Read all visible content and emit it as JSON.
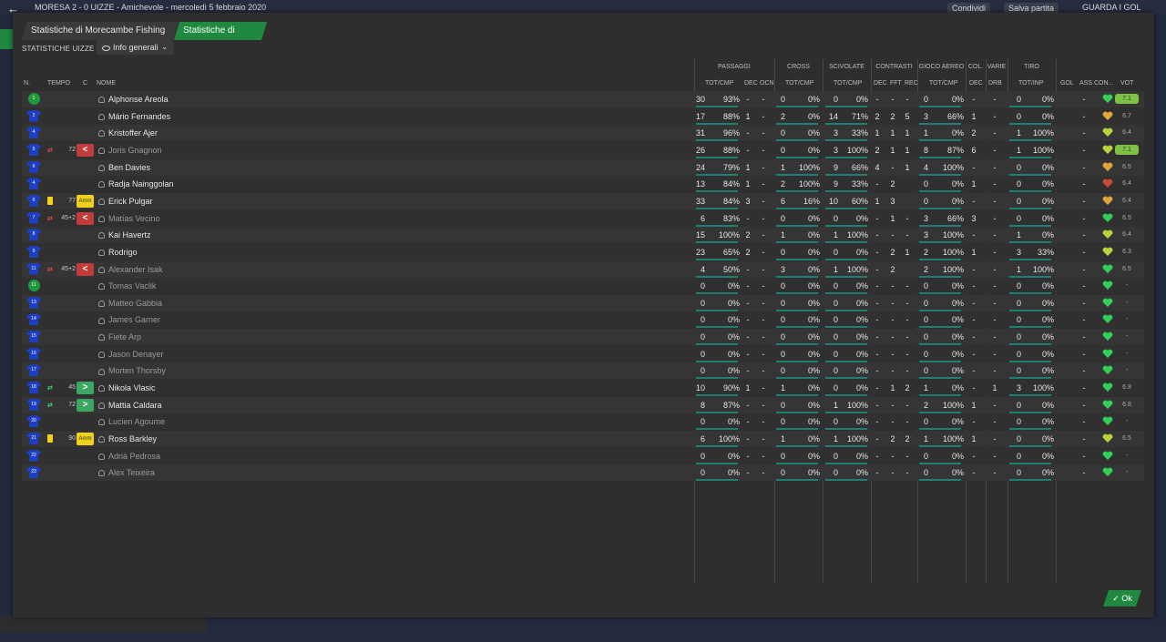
{
  "topbar": {
    "back": "←",
    "match": "MORESA 2 - 0 UIZZE - Amichevole - mercoledì 5 febbraio 2020",
    "share": "Condividi",
    "save": "Salva partita",
    "goals": "GUARDA I GOL"
  },
  "tabs": [
    {
      "label": "Statistiche di Morecambe Fishing Club"
    },
    {
      "label": "Statistiche di Uizze FC"
    }
  ],
  "filter": {
    "label": "STATISTICHE UIZZE FC",
    "value": "Info generali",
    "chevron": "⌄"
  },
  "groups": [
    "PASSAGGI",
    "CROSS",
    "SCIVOLATE",
    "CONTRASTI",
    "GIOCO AEREO",
    "COL.",
    "VARIE",
    "TIRO"
  ],
  "columns": {
    "n": "N.",
    "tempo": "TEMPO",
    "c": "C",
    "nome": "NOME",
    "pass": "TOT/CMP",
    "pdec": "DEC",
    "pocn": "OCN",
    "cross": "TOT/CMP",
    "sciv": "TOT/CMP",
    "cdec": "DEC",
    "cfft": "FFT",
    "crec": "REC",
    "aereo": "TOT/CMP",
    "coldec": "DEC",
    "drb": "DRB",
    "tiro": "TOT/INP",
    "gol": "GOL",
    "ass": "ASS",
    "con": "CON...",
    "vot": "VOT"
  },
  "colors": {
    "accent": "#1f8a3f",
    "bar": "#1f7f72",
    "jersey": "#1d3fc4"
  },
  "players": [
    {
      "n": "1",
      "gk": true,
      "name": "Alphonse Areola",
      "mins": "",
      "ev": "",
      "evtype": "",
      "card": false,
      "subin": false,
      "subout": false,
      "dim": false,
      "pt": "30",
      "pp": "93%",
      "pdec": "-",
      "pocn": "-",
      "ct": "0",
      "cp": "0%",
      "st": "0",
      "sp": "0%",
      "kd": "-",
      "kf": "-",
      "kr": "-",
      "at": "0",
      "ap": "0%",
      "cd": "-",
      "drb": "-",
      "tt": "0",
      "tp": "0%",
      "gol": "",
      "ass": "-",
      "mor": "g",
      "vot": "7.1",
      "hi": true
    },
    {
      "n": "2",
      "gk": false,
      "name": "Mário Fernandes",
      "mins": "",
      "ev": "",
      "evtype": "",
      "card": false,
      "subin": false,
      "subout": false,
      "dim": false,
      "pt": "17",
      "pp": "88%",
      "pdec": "1",
      "pocn": "-",
      "ct": "2",
      "cp": "0%",
      "st": "14",
      "sp": "71%",
      "kd": "2",
      "kf": "2",
      "kr": "5",
      "at": "3",
      "ap": "66%",
      "cd": "1",
      "drb": "-",
      "tt": "0",
      "tp": "0%",
      "gol": "",
      "ass": "-",
      "mor": "o",
      "vot": "6.7",
      "hi": false
    },
    {
      "n": "4",
      "gk": false,
      "name": "Kristoffer Ajer",
      "mins": "",
      "ev": "",
      "evtype": "",
      "card": false,
      "subin": false,
      "subout": false,
      "dim": false,
      "pt": "31",
      "pp": "96%",
      "pdec": "-",
      "pocn": "-",
      "ct": "0",
      "cp": "0%",
      "st": "3",
      "sp": "33%",
      "kd": "1",
      "kf": "1",
      "kr": "1",
      "at": "1",
      "ap": "0%",
      "cd": "2",
      "drb": "-",
      "tt": "1",
      "tp": "100%",
      "gol": "",
      "ass": "-",
      "mor": "y",
      "vot": "6.4",
      "hi": false
    },
    {
      "n": "5",
      "gk": false,
      "name": "Joris Gnagnon",
      "mins": "72",
      "ev": "<",
      "evtype": "out",
      "card": false,
      "subin": false,
      "subout": true,
      "dim": true,
      "pt": "26",
      "pp": "88%",
      "pdec": "-",
      "pocn": "-",
      "ct": "0",
      "cp": "0%",
      "st": "3",
      "sp": "100%",
      "kd": "2",
      "kf": "1",
      "kr": "1",
      "at": "8",
      "ap": "87%",
      "cd": "6",
      "drb": "-",
      "tt": "1",
      "tp": "100%",
      "gol": "",
      "ass": "-",
      "mor": "y",
      "vot": "7.1",
      "hi": true
    },
    {
      "n": "6",
      "gk": false,
      "name": "Ben Davies",
      "mins": "",
      "ev": "",
      "evtype": "",
      "card": false,
      "subin": false,
      "subout": false,
      "dim": false,
      "pt": "24",
      "pp": "79%",
      "pdec": "1",
      "pocn": "-",
      "ct": "1",
      "cp": "100%",
      "st": "9",
      "sp": "66%",
      "kd": "4",
      "kf": "-",
      "kr": "1",
      "at": "4",
      "ap": "100%",
      "cd": "-",
      "drb": "-",
      "tt": "0",
      "tp": "0%",
      "gol": "",
      "ass": "-",
      "mor": "o",
      "vot": "6.5",
      "hi": false
    },
    {
      "n": "4",
      "gk": false,
      "name": "Radja Nainggolan",
      "mins": "",
      "ev": "",
      "evtype": "",
      "card": false,
      "subin": false,
      "subout": false,
      "dim": false,
      "pt": "13",
      "pp": "84%",
      "pdec": "1",
      "pocn": "-",
      "ct": "2",
      "cp": "100%",
      "st": "9",
      "sp": "33%",
      "kd": "-",
      "kf": "2",
      "kr": "",
      "at": "0",
      "ap": "0%",
      "cd": "1",
      "drb": "-",
      "tt": "0",
      "tp": "0%",
      "gol": "",
      "ass": "-",
      "mor": "r",
      "vot": "6.4",
      "hi": false
    },
    {
      "n": "6",
      "gk": false,
      "name": "Erick Pulgar",
      "mins": "77",
      "ev": "Amm",
      "evtype": "book",
      "card": true,
      "subin": false,
      "subout": false,
      "dim": false,
      "pt": "33",
      "pp": "84%",
      "pdec": "3",
      "pocn": "-",
      "ct": "6",
      "cp": "16%",
      "st": "10",
      "sp": "60%",
      "kd": "1",
      "kf": "3",
      "kr": "",
      "at": "0",
      "ap": "0%",
      "cd": "-",
      "drb": "-",
      "tt": "0",
      "tp": "0%",
      "gol": "",
      "ass": "-",
      "mor": "o",
      "vot": "6.4",
      "hi": false
    },
    {
      "n": "7",
      "gk": false,
      "name": "Matías Vecino",
      "mins": "45+2",
      "ev": "<",
      "evtype": "out",
      "card": false,
      "subin": false,
      "subout": true,
      "dim": true,
      "pt": "6",
      "pp": "83%",
      "pdec": "-",
      "pocn": "-",
      "ct": "0",
      "cp": "0%",
      "st": "0",
      "sp": "0%",
      "kd": "-",
      "kf": "1",
      "kr": "-",
      "at": "3",
      "ap": "66%",
      "cd": "3",
      "drb": "-",
      "tt": "0",
      "tp": "0%",
      "gol": "",
      "ass": "-",
      "mor": "g",
      "vot": "6.5",
      "hi": false
    },
    {
      "n": "8",
      "gk": false,
      "name": "Kai Havertz",
      "mins": "",
      "ev": "",
      "evtype": "",
      "card": false,
      "subin": false,
      "subout": false,
      "dim": false,
      "pt": "15",
      "pp": "100%",
      "pdec": "2",
      "pocn": "-",
      "ct": "1",
      "cp": "0%",
      "st": "1",
      "sp": "100%",
      "kd": "-",
      "kf": "-",
      "kr": "-",
      "at": "3",
      "ap": "100%",
      "cd": "-",
      "drb": "-",
      "tt": "1",
      "tp": "0%",
      "gol": "",
      "ass": "-",
      "mor": "y",
      "vot": "6.4",
      "hi": false
    },
    {
      "n": "9",
      "gk": false,
      "name": "Rodrigo",
      "mins": "",
      "ev": "",
      "evtype": "",
      "card": false,
      "subin": false,
      "subout": false,
      "dim": false,
      "pt": "23",
      "pp": "65%",
      "pdec": "2",
      "pocn": "-",
      "ct": "0",
      "cp": "0%",
      "st": "0",
      "sp": "0%",
      "kd": "-",
      "kf": "2",
      "kr": "1",
      "at": "2",
      "ap": "100%",
      "cd": "1",
      "drb": "-",
      "tt": "3",
      "tp": "33%",
      "gol": "",
      "ass": "-",
      "mor": "y",
      "vot": "6.3",
      "hi": false
    },
    {
      "n": "11",
      "gk": false,
      "name": "Alexander Isak",
      "mins": "45+2",
      "ev": "<",
      "evtype": "out",
      "card": false,
      "subin": false,
      "subout": true,
      "dim": true,
      "pt": "4",
      "pp": "50%",
      "pdec": "-",
      "pocn": "-",
      "ct": "3",
      "cp": "0%",
      "st": "1",
      "sp": "100%",
      "kd": "-",
      "kf": "2",
      "kr": "",
      "at": "2",
      "ap": "100%",
      "cd": "-",
      "drb": "-",
      "tt": "1",
      "tp": "100%",
      "gol": "",
      "ass": "-",
      "mor": "g",
      "vot": "6.5",
      "hi": false
    },
    {
      "n": "11",
      "gk": true,
      "name": "Tomas Vaclik",
      "mins": "",
      "ev": "",
      "evtype": "",
      "card": false,
      "subin": false,
      "subout": false,
      "dim": true,
      "pt": "0",
      "pp": "0%",
      "pdec": "-",
      "pocn": "-",
      "ct": "0",
      "cp": "0%",
      "st": "0",
      "sp": "0%",
      "kd": "-",
      "kf": "-",
      "kr": "-",
      "at": "0",
      "ap": "0%",
      "cd": "-",
      "drb": "-",
      "tt": "0",
      "tp": "0%",
      "gol": "",
      "ass": "-",
      "mor": "g",
      "vot": "-",
      "hi": false
    },
    {
      "n": "13",
      "gk": false,
      "name": "Matteo Gabbia",
      "mins": "",
      "ev": "",
      "evtype": "",
      "card": false,
      "subin": false,
      "subout": false,
      "dim": true,
      "pt": "0",
      "pp": "0%",
      "pdec": "-",
      "pocn": "-",
      "ct": "0",
      "cp": "0%",
      "st": "0",
      "sp": "0%",
      "kd": "-",
      "kf": "-",
      "kr": "-",
      "at": "0",
      "ap": "0%",
      "cd": "-",
      "drb": "-",
      "tt": "0",
      "tp": "0%",
      "gol": "",
      "ass": "-",
      "mor": "g",
      "vot": "-",
      "hi": false
    },
    {
      "n": "14",
      "gk": false,
      "name": "James Garner",
      "mins": "",
      "ev": "",
      "evtype": "",
      "card": false,
      "subin": false,
      "subout": false,
      "dim": true,
      "pt": "0",
      "pp": "0%",
      "pdec": "-",
      "pocn": "-",
      "ct": "0",
      "cp": "0%",
      "st": "0",
      "sp": "0%",
      "kd": "-",
      "kf": "-",
      "kr": "-",
      "at": "0",
      "ap": "0%",
      "cd": "-",
      "drb": "-",
      "tt": "0",
      "tp": "0%",
      "gol": "",
      "ass": "-",
      "mor": "g",
      "vot": "-",
      "hi": false
    },
    {
      "n": "15",
      "gk": false,
      "name": "Fiete Arp",
      "mins": "",
      "ev": "",
      "evtype": "",
      "card": false,
      "subin": false,
      "subout": false,
      "dim": true,
      "pt": "0",
      "pp": "0%",
      "pdec": "-",
      "pocn": "-",
      "ct": "0",
      "cp": "0%",
      "st": "0",
      "sp": "0%",
      "kd": "-",
      "kf": "-",
      "kr": "-",
      "at": "0",
      "ap": "0%",
      "cd": "-",
      "drb": "-",
      "tt": "0",
      "tp": "0%",
      "gol": "",
      "ass": "-",
      "mor": "g",
      "vot": "-",
      "hi": false
    },
    {
      "n": "16",
      "gk": false,
      "name": "Jason Denayer",
      "mins": "",
      "ev": "",
      "evtype": "",
      "card": false,
      "subin": false,
      "subout": false,
      "dim": true,
      "pt": "0",
      "pp": "0%",
      "pdec": "-",
      "pocn": "-",
      "ct": "0",
      "cp": "0%",
      "st": "0",
      "sp": "0%",
      "kd": "-",
      "kf": "-",
      "kr": "-",
      "at": "0",
      "ap": "0%",
      "cd": "-",
      "drb": "-",
      "tt": "0",
      "tp": "0%",
      "gol": "",
      "ass": "-",
      "mor": "g",
      "vot": "-",
      "hi": false
    },
    {
      "n": "17",
      "gk": false,
      "name": "Morten Thorsby",
      "mins": "",
      "ev": "",
      "evtype": "",
      "card": false,
      "subin": false,
      "subout": false,
      "dim": true,
      "pt": "0",
      "pp": "0%",
      "pdec": "-",
      "pocn": "-",
      "ct": "0",
      "cp": "0%",
      "st": "0",
      "sp": "0%",
      "kd": "-",
      "kf": "-",
      "kr": "-",
      "at": "0",
      "ap": "0%",
      "cd": "-",
      "drb": "-",
      "tt": "0",
      "tp": "0%",
      "gol": "",
      "ass": "-",
      "mor": "g",
      "vot": "-",
      "hi": false
    },
    {
      "n": "18",
      "gk": false,
      "name": "Nikola Vlasic",
      "mins": "45",
      "ev": ">",
      "evtype": "in",
      "card": false,
      "subin": true,
      "subout": false,
      "dim": false,
      "pt": "10",
      "pp": "90%",
      "pdec": "1",
      "pocn": "-",
      "ct": "1",
      "cp": "0%",
      "st": "0",
      "sp": "0%",
      "kd": "-",
      "kf": "1",
      "kr": "2",
      "at": "1",
      "ap": "0%",
      "cd": "-",
      "drb": "1",
      "tt": "3",
      "tp": "100%",
      "gol": "",
      "ass": "-",
      "mor": "g",
      "vot": "6.8",
      "hi": false
    },
    {
      "n": "19",
      "gk": false,
      "name": "Mattia Caldara",
      "mins": "72",
      "ev": ">",
      "evtype": "in",
      "card": false,
      "subin": true,
      "subout": false,
      "dim": false,
      "pt": "8",
      "pp": "87%",
      "pdec": "-",
      "pocn": "-",
      "ct": "0",
      "cp": "0%",
      "st": "1",
      "sp": "100%",
      "kd": "-",
      "kf": "-",
      "kr": "-",
      "at": "2",
      "ap": "100%",
      "cd": "1",
      "drb": "-",
      "tt": "0",
      "tp": "0%",
      "gol": "",
      "ass": "-",
      "mor": "g",
      "vot": "6.8",
      "hi": false
    },
    {
      "n": "20",
      "gk": false,
      "name": "Lucien Agoume",
      "mins": "",
      "ev": "",
      "evtype": "",
      "card": false,
      "subin": false,
      "subout": false,
      "dim": true,
      "pt": "0",
      "pp": "0%",
      "pdec": "-",
      "pocn": "-",
      "ct": "0",
      "cp": "0%",
      "st": "0",
      "sp": "0%",
      "kd": "-",
      "kf": "-",
      "kr": "-",
      "at": "0",
      "ap": "0%",
      "cd": "-",
      "drb": "-",
      "tt": "0",
      "tp": "0%",
      "gol": "",
      "ass": "-",
      "mor": "g",
      "vot": "-",
      "hi": false
    },
    {
      "n": "21",
      "gk": false,
      "name": "Ross Barkley",
      "mins": "90",
      "ev": "Amm",
      "evtype": "book",
      "card": true,
      "subin": false,
      "subout": false,
      "dim": false,
      "pt": "6",
      "pp": "100%",
      "pdec": "-",
      "pocn": "-",
      "ct": "1",
      "cp": "0%",
      "st": "1",
      "sp": "100%",
      "kd": "-",
      "kf": "2",
      "kr": "2",
      "at": "1",
      "ap": "100%",
      "cd": "1",
      "drb": "-",
      "tt": "0",
      "tp": "0%",
      "gol": "",
      "ass": "-",
      "mor": "y",
      "vot": "6.5",
      "hi": false
    },
    {
      "n": "22",
      "gk": false,
      "name": "Adrià Pedrosa",
      "mins": "",
      "ev": "",
      "evtype": "",
      "card": false,
      "subin": false,
      "subout": false,
      "dim": true,
      "pt": "0",
      "pp": "0%",
      "pdec": "-",
      "pocn": "-",
      "ct": "0",
      "cp": "0%",
      "st": "0",
      "sp": "0%",
      "kd": "-",
      "kf": "-",
      "kr": "-",
      "at": "0",
      "ap": "0%",
      "cd": "-",
      "drb": "-",
      "tt": "0",
      "tp": "0%",
      "gol": "",
      "ass": "-",
      "mor": "g",
      "vot": "-",
      "hi": false
    },
    {
      "n": "23",
      "gk": false,
      "name": "Alex Teixeira",
      "mins": "",
      "ev": "",
      "evtype": "",
      "card": false,
      "subin": false,
      "subout": false,
      "dim": true,
      "pt": "0",
      "pp": "0%",
      "pdec": "-",
      "pocn": "-",
      "ct": "0",
      "cp": "0%",
      "st": "0",
      "sp": "0%",
      "kd": "-",
      "kf": "-",
      "kr": "-",
      "at": "0",
      "ap": "0%",
      "cd": "-",
      "drb": "-",
      "tt": "0",
      "tp": "0%",
      "gol": "",
      "ass": "-",
      "mor": "g",
      "vot": "-",
      "hi": false
    }
  ],
  "ok": "Ok"
}
